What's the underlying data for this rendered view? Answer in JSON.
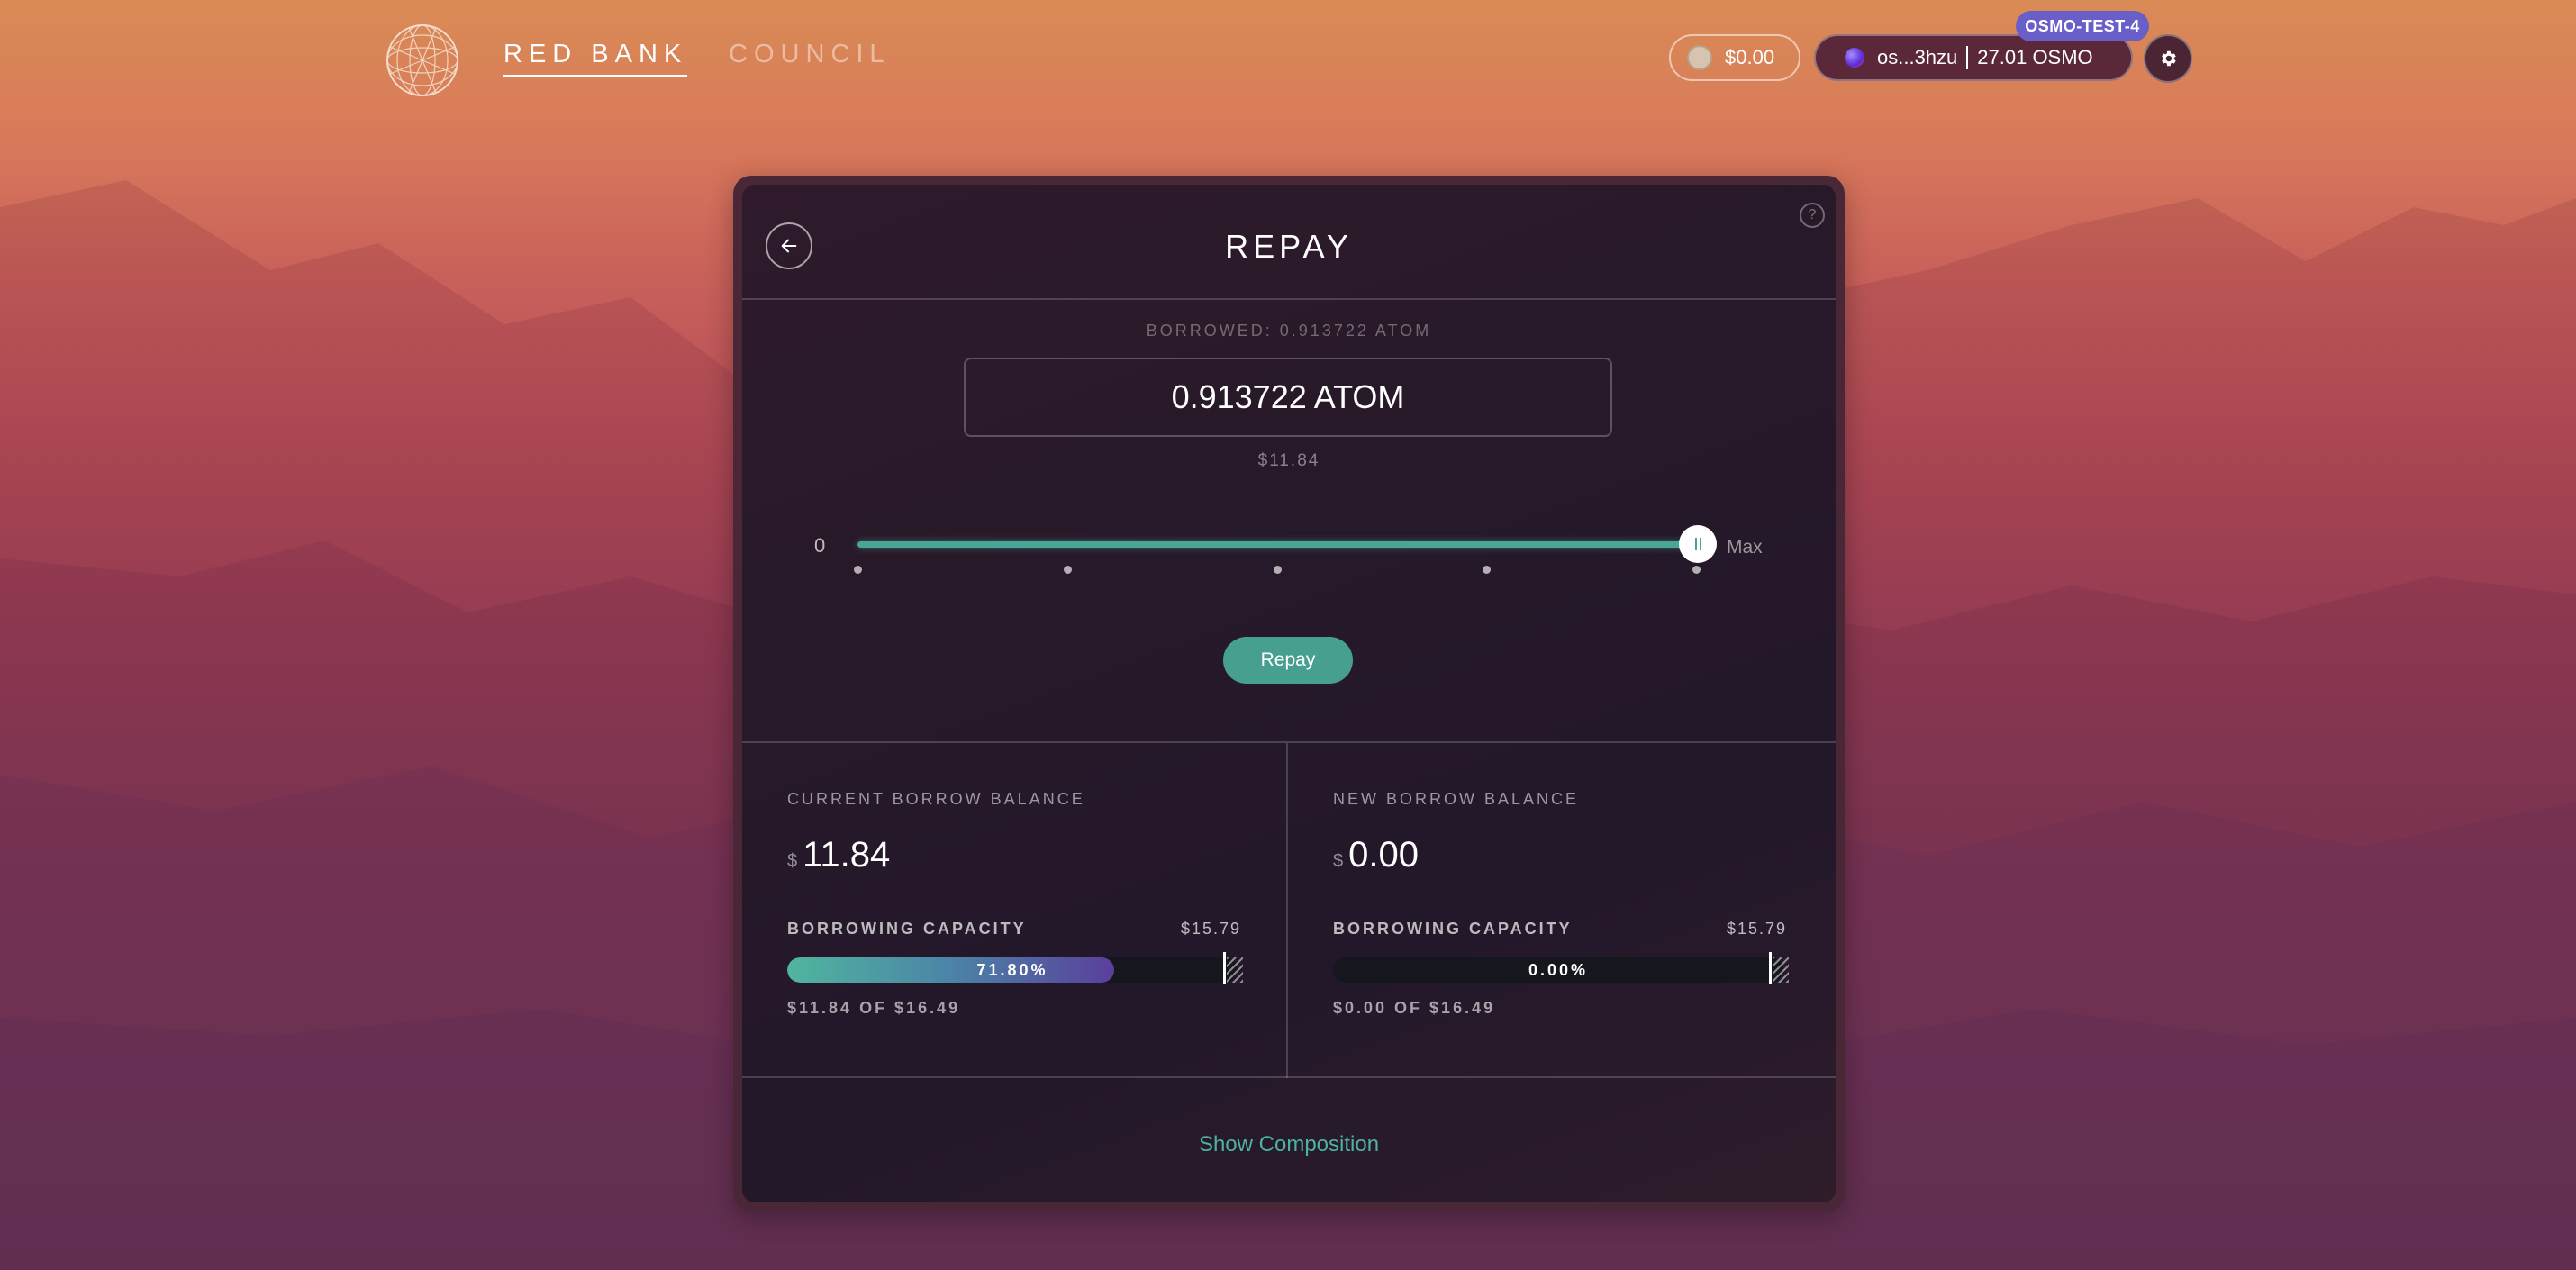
{
  "header": {
    "nav": {
      "red_bank": "RED BANK",
      "council": "COUNCIL"
    },
    "balance": "$0.00",
    "wallet": {
      "address": "os...3hzu",
      "amount": "27.01 OSMO"
    },
    "network": "OSMO-TEST-4",
    "icons": {
      "logo": "geodesic-sphere-logo",
      "settings": "gear-icon"
    }
  },
  "repay": {
    "title": "REPAY",
    "help_label": "?",
    "borrowed_label": "BORROWED: 0.913722 ATOM",
    "amount_value": "0.913722 ATOM",
    "usd_value": "$11.84",
    "slider": {
      "min_label": "0",
      "max_label": "Max",
      "value_fraction": 1.0,
      "tick_count": 5
    },
    "button_label": "Repay"
  },
  "current": {
    "label": "CURRENT BORROW BALANCE",
    "dollar": "$",
    "value": "11.84",
    "capacity_label": "BORROWING CAPACITY",
    "capacity_value": "$15.79",
    "bar_text": "71.80%",
    "bar_fraction": 0.718,
    "sub": "$11.84 OF $16.49"
  },
  "new": {
    "label": "NEW BORROW BALANCE",
    "dollar": "$",
    "value": "0.00",
    "capacity_label": "BORROWING CAPACITY",
    "capacity_value": "$15.79",
    "bar_text": "0.00%",
    "bar_fraction": 0.0,
    "sub": "$0.00 OF $16.49"
  },
  "show_composition": "Show Composition",
  "colors": {
    "accent": "#479f8f",
    "network_badge": "#6a5ec9",
    "card_bg": "#261929"
  }
}
